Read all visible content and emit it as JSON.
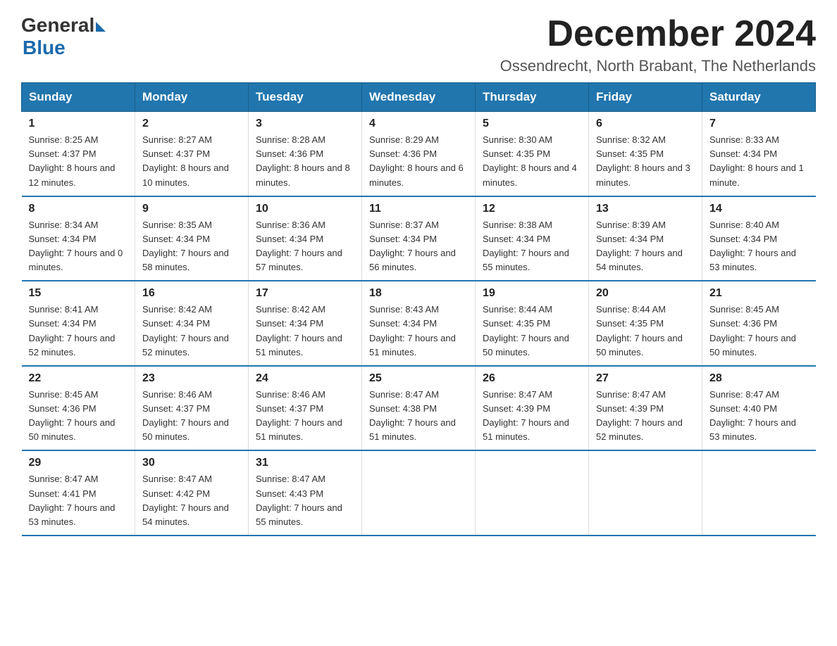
{
  "logo": {
    "text_general": "General",
    "text_blue": "Blue"
  },
  "title": "December 2024",
  "subtitle": "Ossendrecht, North Brabant, The Netherlands",
  "days_of_week": [
    "Sunday",
    "Monday",
    "Tuesday",
    "Wednesday",
    "Thursday",
    "Friday",
    "Saturday"
  ],
  "weeks": [
    [
      {
        "day": "1",
        "sunrise": "8:25 AM",
        "sunset": "4:37 PM",
        "daylight": "8 hours and 12 minutes."
      },
      {
        "day": "2",
        "sunrise": "8:27 AM",
        "sunset": "4:37 PM",
        "daylight": "8 hours and 10 minutes."
      },
      {
        "day": "3",
        "sunrise": "8:28 AM",
        "sunset": "4:36 PM",
        "daylight": "8 hours and 8 minutes."
      },
      {
        "day": "4",
        "sunrise": "8:29 AM",
        "sunset": "4:36 PM",
        "daylight": "8 hours and 6 minutes."
      },
      {
        "day": "5",
        "sunrise": "8:30 AM",
        "sunset": "4:35 PM",
        "daylight": "8 hours and 4 minutes."
      },
      {
        "day": "6",
        "sunrise": "8:32 AM",
        "sunset": "4:35 PM",
        "daylight": "8 hours and 3 minutes."
      },
      {
        "day": "7",
        "sunrise": "8:33 AM",
        "sunset": "4:34 PM",
        "daylight": "8 hours and 1 minute."
      }
    ],
    [
      {
        "day": "8",
        "sunrise": "8:34 AM",
        "sunset": "4:34 PM",
        "daylight": "7 hours and 0 minutes."
      },
      {
        "day": "9",
        "sunrise": "8:35 AM",
        "sunset": "4:34 PM",
        "daylight": "7 hours and 58 minutes."
      },
      {
        "day": "10",
        "sunrise": "8:36 AM",
        "sunset": "4:34 PM",
        "daylight": "7 hours and 57 minutes."
      },
      {
        "day": "11",
        "sunrise": "8:37 AM",
        "sunset": "4:34 PM",
        "daylight": "7 hours and 56 minutes."
      },
      {
        "day": "12",
        "sunrise": "8:38 AM",
        "sunset": "4:34 PM",
        "daylight": "7 hours and 55 minutes."
      },
      {
        "day": "13",
        "sunrise": "8:39 AM",
        "sunset": "4:34 PM",
        "daylight": "7 hours and 54 minutes."
      },
      {
        "day": "14",
        "sunrise": "8:40 AM",
        "sunset": "4:34 PM",
        "daylight": "7 hours and 53 minutes."
      }
    ],
    [
      {
        "day": "15",
        "sunrise": "8:41 AM",
        "sunset": "4:34 PM",
        "daylight": "7 hours and 52 minutes."
      },
      {
        "day": "16",
        "sunrise": "8:42 AM",
        "sunset": "4:34 PM",
        "daylight": "7 hours and 52 minutes."
      },
      {
        "day": "17",
        "sunrise": "8:42 AM",
        "sunset": "4:34 PM",
        "daylight": "7 hours and 51 minutes."
      },
      {
        "day": "18",
        "sunrise": "8:43 AM",
        "sunset": "4:34 PM",
        "daylight": "7 hours and 51 minutes."
      },
      {
        "day": "19",
        "sunrise": "8:44 AM",
        "sunset": "4:35 PM",
        "daylight": "7 hours and 50 minutes."
      },
      {
        "day": "20",
        "sunrise": "8:44 AM",
        "sunset": "4:35 PM",
        "daylight": "7 hours and 50 minutes."
      },
      {
        "day": "21",
        "sunrise": "8:45 AM",
        "sunset": "4:36 PM",
        "daylight": "7 hours and 50 minutes."
      }
    ],
    [
      {
        "day": "22",
        "sunrise": "8:45 AM",
        "sunset": "4:36 PM",
        "daylight": "7 hours and 50 minutes."
      },
      {
        "day": "23",
        "sunrise": "8:46 AM",
        "sunset": "4:37 PM",
        "daylight": "7 hours and 50 minutes."
      },
      {
        "day": "24",
        "sunrise": "8:46 AM",
        "sunset": "4:37 PM",
        "daylight": "7 hours and 51 minutes."
      },
      {
        "day": "25",
        "sunrise": "8:47 AM",
        "sunset": "4:38 PM",
        "daylight": "7 hours and 51 minutes."
      },
      {
        "day": "26",
        "sunrise": "8:47 AM",
        "sunset": "4:39 PM",
        "daylight": "7 hours and 51 minutes."
      },
      {
        "day": "27",
        "sunrise": "8:47 AM",
        "sunset": "4:39 PM",
        "daylight": "7 hours and 52 minutes."
      },
      {
        "day": "28",
        "sunrise": "8:47 AM",
        "sunset": "4:40 PM",
        "daylight": "7 hours and 53 minutes."
      }
    ],
    [
      {
        "day": "29",
        "sunrise": "8:47 AM",
        "sunset": "4:41 PM",
        "daylight": "7 hours and 53 minutes."
      },
      {
        "day": "30",
        "sunrise": "8:47 AM",
        "sunset": "4:42 PM",
        "daylight": "7 hours and 54 minutes."
      },
      {
        "day": "31",
        "sunrise": "8:47 AM",
        "sunset": "4:43 PM",
        "daylight": "7 hours and 55 minutes."
      },
      null,
      null,
      null,
      null
    ]
  ],
  "labels": {
    "sunrise_prefix": "Sunrise: ",
    "sunset_prefix": "Sunset: ",
    "daylight_prefix": "Daylight: "
  },
  "colors": {
    "header_bg": "#2176ae",
    "header_text": "#ffffff",
    "border": "#2176ae"
  }
}
